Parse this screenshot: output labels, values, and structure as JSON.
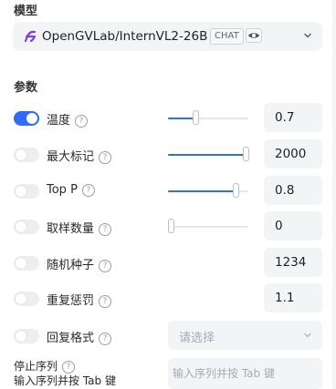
{
  "model_section": {
    "title": "模型",
    "selected_model": "OpenGVLab/InternVL2-26B",
    "badge_chat": "CHAT",
    "badge_vision_icon": "eye-icon",
    "accent": "#2f6df6"
  },
  "params_section": {
    "title": "参数",
    "help_glyph": "?",
    "items": [
      {
        "label": "温度",
        "enabled": true,
        "control": "slider",
        "slider_fraction": 0.35,
        "value": "0.7"
      },
      {
        "label": "最大标记",
        "enabled": false,
        "control": "slider",
        "slider_fraction": 1.0,
        "value": "2000"
      },
      {
        "label": "Top P",
        "enabled": false,
        "control": "slider",
        "slider_fraction": 0.85,
        "value": "0.8"
      },
      {
        "label": "取样数量",
        "enabled": false,
        "control": "slider",
        "slider_fraction": 0.0,
        "value": "0"
      },
      {
        "label": "随机种子",
        "enabled": false,
        "control": "number",
        "value": "1234"
      },
      {
        "label": "重复惩罚",
        "enabled": false,
        "control": "number",
        "value": "1.1"
      },
      {
        "label": "回复格式",
        "enabled": false,
        "control": "select",
        "placeholder": "请选择"
      }
    ],
    "stop_sequences": {
      "label": "停止序列",
      "sublabel": "输入序列并按 Tab 键",
      "placeholder": "输入序列并按 Tab 键"
    }
  }
}
